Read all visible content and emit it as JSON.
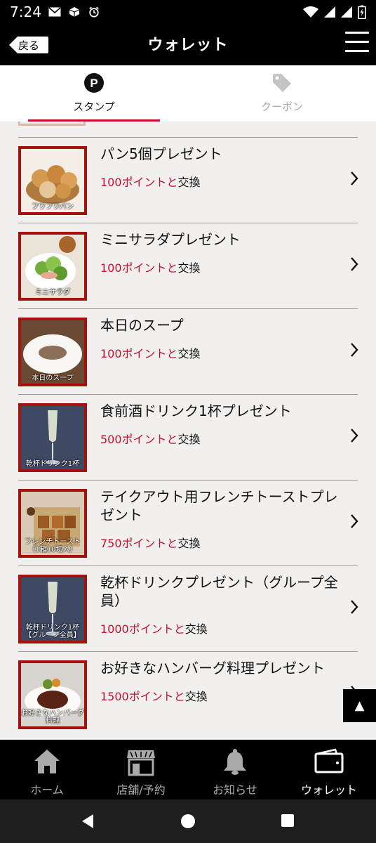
{
  "status_bar": {
    "time": "7:24"
  },
  "header": {
    "back_label": "戻る",
    "title": "ウォレット"
  },
  "tabs": [
    {
      "label": "スタンプ",
      "icon": "p-circle-icon",
      "active": true
    },
    {
      "label": "クーポン",
      "icon": "tag-icon",
      "active": false
    }
  ],
  "rewards": [
    {
      "name": "パン5個プレゼント",
      "points": "100ポイントと",
      "suffix": "交換",
      "thumb_caption": "フワフワパン"
    },
    {
      "name": "ミニサラダプレゼント",
      "points": "100ポイントと",
      "suffix": "交換",
      "thumb_caption": "ミニサラダ"
    },
    {
      "name": "本日のスープ",
      "points": "100ポイントと",
      "suffix": "交換",
      "thumb_caption": "本日のスープ"
    },
    {
      "name": "食前酒ドリンク1杯プレゼント",
      "points": "500ポイントと",
      "suffix": "交換",
      "thumb_caption": "乾杯ドリンク1杯"
    },
    {
      "name": "テイクアウト用フレンチトーストプレゼント",
      "points": "750ポイントと",
      "suffix": "交換",
      "thumb_caption": "フレンチトースト（1箱10切入）"
    },
    {
      "name": "乾杯ドリンクプレゼント（グループ全員）",
      "points": "1000ポイントと",
      "suffix": "交換",
      "thumb_caption": "乾杯ドリンク1杯【グループ全員】"
    },
    {
      "name": "お好きなハンバーグ料理プレゼント",
      "points": "1500ポイントと",
      "suffix": "交換",
      "thumb_caption": "お好きなハンバーグ料理"
    }
  ],
  "scroll_top": {
    "label": "▲"
  },
  "bottom_nav": [
    {
      "label": "ホーム",
      "icon": "home-icon",
      "active": false
    },
    {
      "label": "店舗/予約",
      "icon": "store-icon",
      "active": false
    },
    {
      "label": "お知らせ",
      "icon": "bell-icon",
      "active": false
    },
    {
      "label": "ウォレット",
      "icon": "wallet-icon",
      "active": true
    }
  ],
  "colors": {
    "accent": "#c8102e",
    "thumb_border": "#a5120e",
    "header_bg": "#000000",
    "list_bg": "#f1f0ef"
  }
}
